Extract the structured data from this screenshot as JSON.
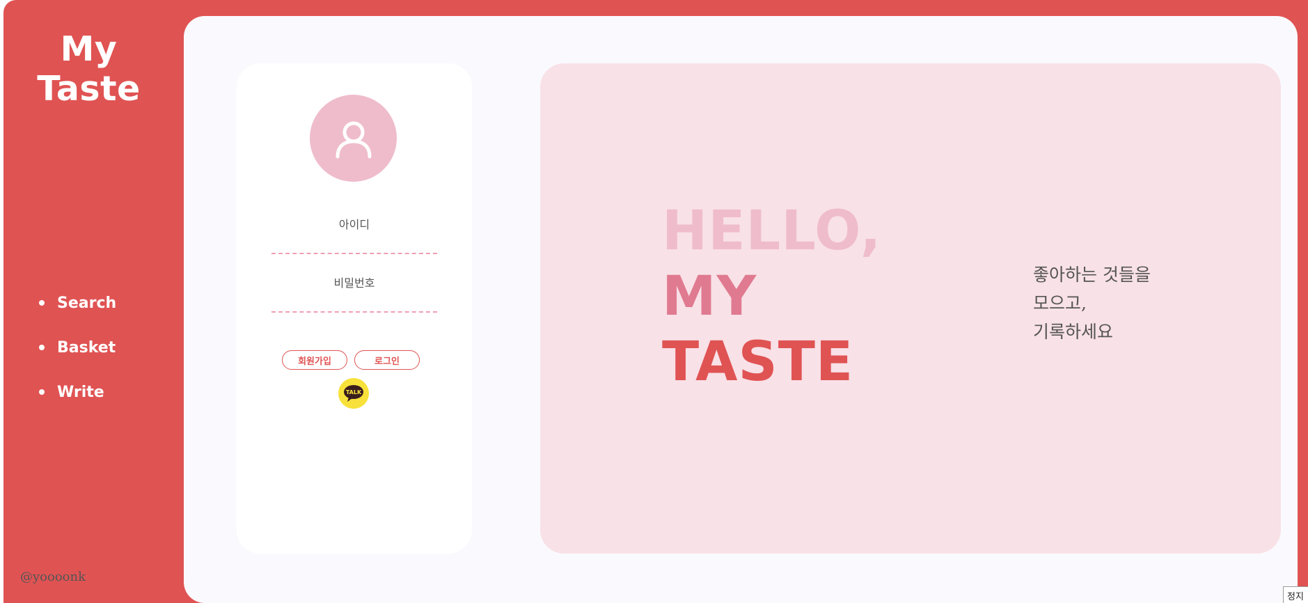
{
  "brand": {
    "line1": "My",
    "line2": "Taste"
  },
  "nav": {
    "items": [
      {
        "label": "Search"
      },
      {
        "label": "Basket"
      },
      {
        "label": "Write"
      }
    ]
  },
  "footer": {
    "handle": "@yoooonk"
  },
  "login": {
    "id_label": "아이디",
    "password_label": "비밀번호",
    "signup_label": "회원가입",
    "login_label": "로그인",
    "kakao_text": "TALK"
  },
  "hero": {
    "line1": "HELLO,",
    "line2": "MY",
    "line3": "TASTE",
    "tagline": [
      "좋아하는 것들을",
      "모으고,",
      "기록하세요"
    ]
  },
  "corner_tab": {
    "label": "정지"
  },
  "colors": {
    "brand_red": "#e05353",
    "light_pink": "#efbccb",
    "mid_pink": "#e07a90",
    "hero_bg": "#f8e1e7",
    "kakao_yellow": "#f7e13a"
  },
  "icons": {
    "avatar": "user-icon",
    "kakao": "kakao-talk-icon"
  }
}
